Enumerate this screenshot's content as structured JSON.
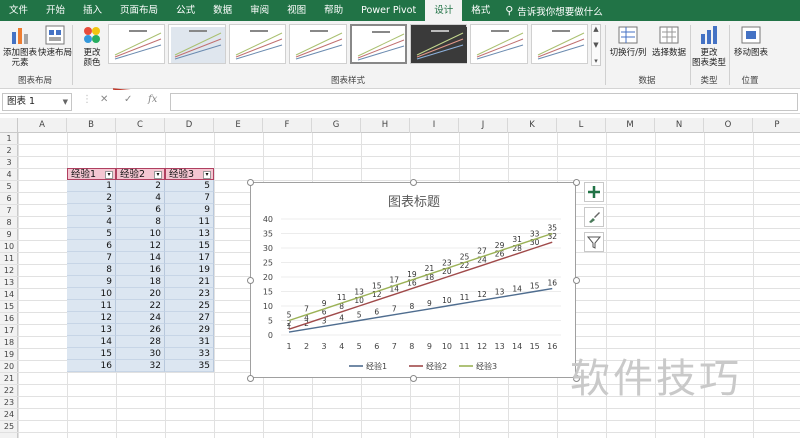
{
  "menu": {
    "tabs": [
      "文件",
      "开始",
      "插入",
      "页面布局",
      "公式",
      "数据",
      "审阅",
      "视图",
      "帮助",
      "Power Pivot",
      "设计",
      "格式"
    ],
    "active_index": 10,
    "tellme": "告诉我你想要做什么"
  },
  "ribbon": {
    "add_element": "添加图表\n元素",
    "quick_layout": "快速布局",
    "change_color": "更改\n颜色",
    "group_layout": "图表布局",
    "group_styles": "图表样式",
    "switch_rowcol": "切换行/列",
    "select_data": "选择数据",
    "group_data": "数据",
    "change_type": "更改\n图表类型",
    "group_type": "类型",
    "move_chart": "移动图表",
    "group_location": "位置"
  },
  "formula": {
    "namebox": "图表 1",
    "value": ""
  },
  "columns": [
    "A",
    "B",
    "C",
    "D",
    "E",
    "F",
    "G",
    "H",
    "I",
    "J",
    "K",
    "L",
    "M",
    "N",
    "O",
    "P"
  ],
  "rows": [
    "1",
    "2",
    "3",
    "4",
    "5",
    "6",
    "7",
    "8",
    "9",
    "10",
    "11",
    "12",
    "13",
    "14",
    "15",
    "16",
    "17",
    "18",
    "19",
    "20",
    "21",
    "22",
    "23",
    "24",
    "25"
  ],
  "table": {
    "headers": [
      "经验1",
      "经验2",
      "经验3"
    ],
    "rows": [
      [
        1,
        2,
        5
      ],
      [
        2,
        4,
        7
      ],
      [
        3,
        6,
        9
      ],
      [
        4,
        8,
        11
      ],
      [
        5,
        10,
        13
      ],
      [
        6,
        12,
        15
      ],
      [
        7,
        14,
        17
      ],
      [
        8,
        16,
        19
      ],
      [
        9,
        18,
        21
      ],
      [
        10,
        20,
        23
      ],
      [
        11,
        22,
        25
      ],
      [
        12,
        24,
        27
      ],
      [
        13,
        26,
        29
      ],
      [
        14,
        28,
        31
      ],
      [
        15,
        30,
        33
      ],
      [
        16,
        32,
        35
      ]
    ]
  },
  "chart_data": {
    "type": "line",
    "title": "图表标题",
    "x": [
      1,
      2,
      3,
      4,
      5,
      6,
      7,
      8,
      9,
      10,
      11,
      12,
      13,
      14,
      15,
      16
    ],
    "ylim": [
      0,
      40
    ],
    "yticks": [
      0,
      5,
      10,
      15,
      20,
      25,
      30,
      35,
      40
    ],
    "series": [
      {
        "name": "经验1",
        "color": "#4f6d8f",
        "values": [
          1,
          2,
          3,
          4,
          5,
          6,
          7,
          8,
          9,
          10,
          11,
          12,
          13,
          14,
          15,
          16
        ]
      },
      {
        "name": "经验2",
        "color": "#a04a4a",
        "values": [
          2,
          4,
          6,
          8,
          10,
          12,
          14,
          16,
          18,
          20,
          22,
          24,
          26,
          28,
          30,
          32
        ]
      },
      {
        "name": "经验3",
        "color": "#9bb256",
        "values": [
          5,
          7,
          9,
          11,
          13,
          15,
          17,
          19,
          21,
          23,
          25,
          27,
          29,
          31,
          33,
          35
        ]
      }
    ],
    "legend": "bottom"
  },
  "chart_buttons": {
    "plus": "+"
  },
  "watermark": "软件技巧"
}
